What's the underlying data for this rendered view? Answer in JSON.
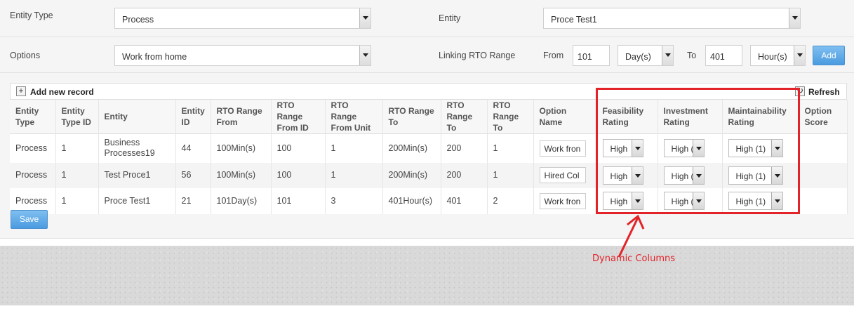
{
  "filters": {
    "entity_type_label": "Entity Type",
    "entity_type_value": "Process",
    "entity_label": "Entity",
    "entity_value": "Proce Test1",
    "options_label": "Options",
    "options_value": "Work from home",
    "linking_label": "Linking RTO Range",
    "from_label": "From",
    "from_value": "101",
    "from_unit": "Day(s)",
    "to_label": "To",
    "to_value": "401",
    "to_unit": "Hour(s)",
    "add_label": "Add"
  },
  "toolbar": {
    "add_icon": "plus-icon",
    "add_label": "Add new record",
    "refresh_icon": "refresh-icon",
    "refresh_label": "Refresh"
  },
  "grid": {
    "headers": [
      [
        "Entity",
        "Type"
      ],
      [
        "Entity",
        "Type ID"
      ],
      [
        "Entity",
        ""
      ],
      [
        "Entity",
        "ID"
      ],
      [
        "RTO Range",
        "From"
      ],
      [
        "RTO Range",
        "From ID"
      ],
      [
        "RTO Range",
        "From Unit"
      ],
      [
        "RTO Range",
        "To"
      ],
      [
        "RTO",
        "Range To"
      ],
      [
        "RTO",
        "Range To"
      ],
      [
        "Option Name",
        ""
      ],
      [
        "Feasibility",
        "Rating"
      ],
      [
        "Investment",
        "Rating"
      ],
      [
        "Maintainability",
        "Rating"
      ],
      [
        "Option",
        "Score"
      ]
    ],
    "rows": [
      {
        "entity_type": "Process",
        "entity_type_id": "1",
        "entity": "Business Processes19",
        "entity_id": "44",
        "rto_from": "100Min(s)",
        "rto_from_id": "100",
        "rto_from_unit": "1",
        "rto_to": "200Min(s)",
        "rto_range_to": "200",
        "rto_range_to2": "1",
        "option_name": "Work fron",
        "feasibility": "High",
        "investment": "High (",
        "maintainability": "High (1)",
        "option_score": ""
      },
      {
        "entity_type": "Process",
        "entity_type_id": "1",
        "entity": "Test Proce1",
        "entity_id": "56",
        "rto_from": "100Min(s)",
        "rto_from_id": "100",
        "rto_from_unit": "1",
        "rto_to": "200Min(s)",
        "rto_range_to": "200",
        "rto_range_to2": "1",
        "option_name": "Hired Col",
        "feasibility": "High",
        "investment": "High (",
        "maintainability": "High (1)",
        "option_score": ""
      },
      {
        "entity_type": "Process",
        "entity_type_id": "1",
        "entity": "Proce Test1",
        "entity_id": "21",
        "rto_from": "101Day(s)",
        "rto_from_id": "101",
        "rto_from_unit": "3",
        "rto_to": "401Hour(s)",
        "rto_range_to": "401",
        "rto_range_to2": "2",
        "option_name": "Work fron",
        "feasibility": "High",
        "investment": "High (",
        "maintainability": "High (1)",
        "option_score": ""
      }
    ],
    "save_label": "Save"
  },
  "annotation": {
    "label": "Dynamic Columns",
    "color": "#e2232a"
  }
}
